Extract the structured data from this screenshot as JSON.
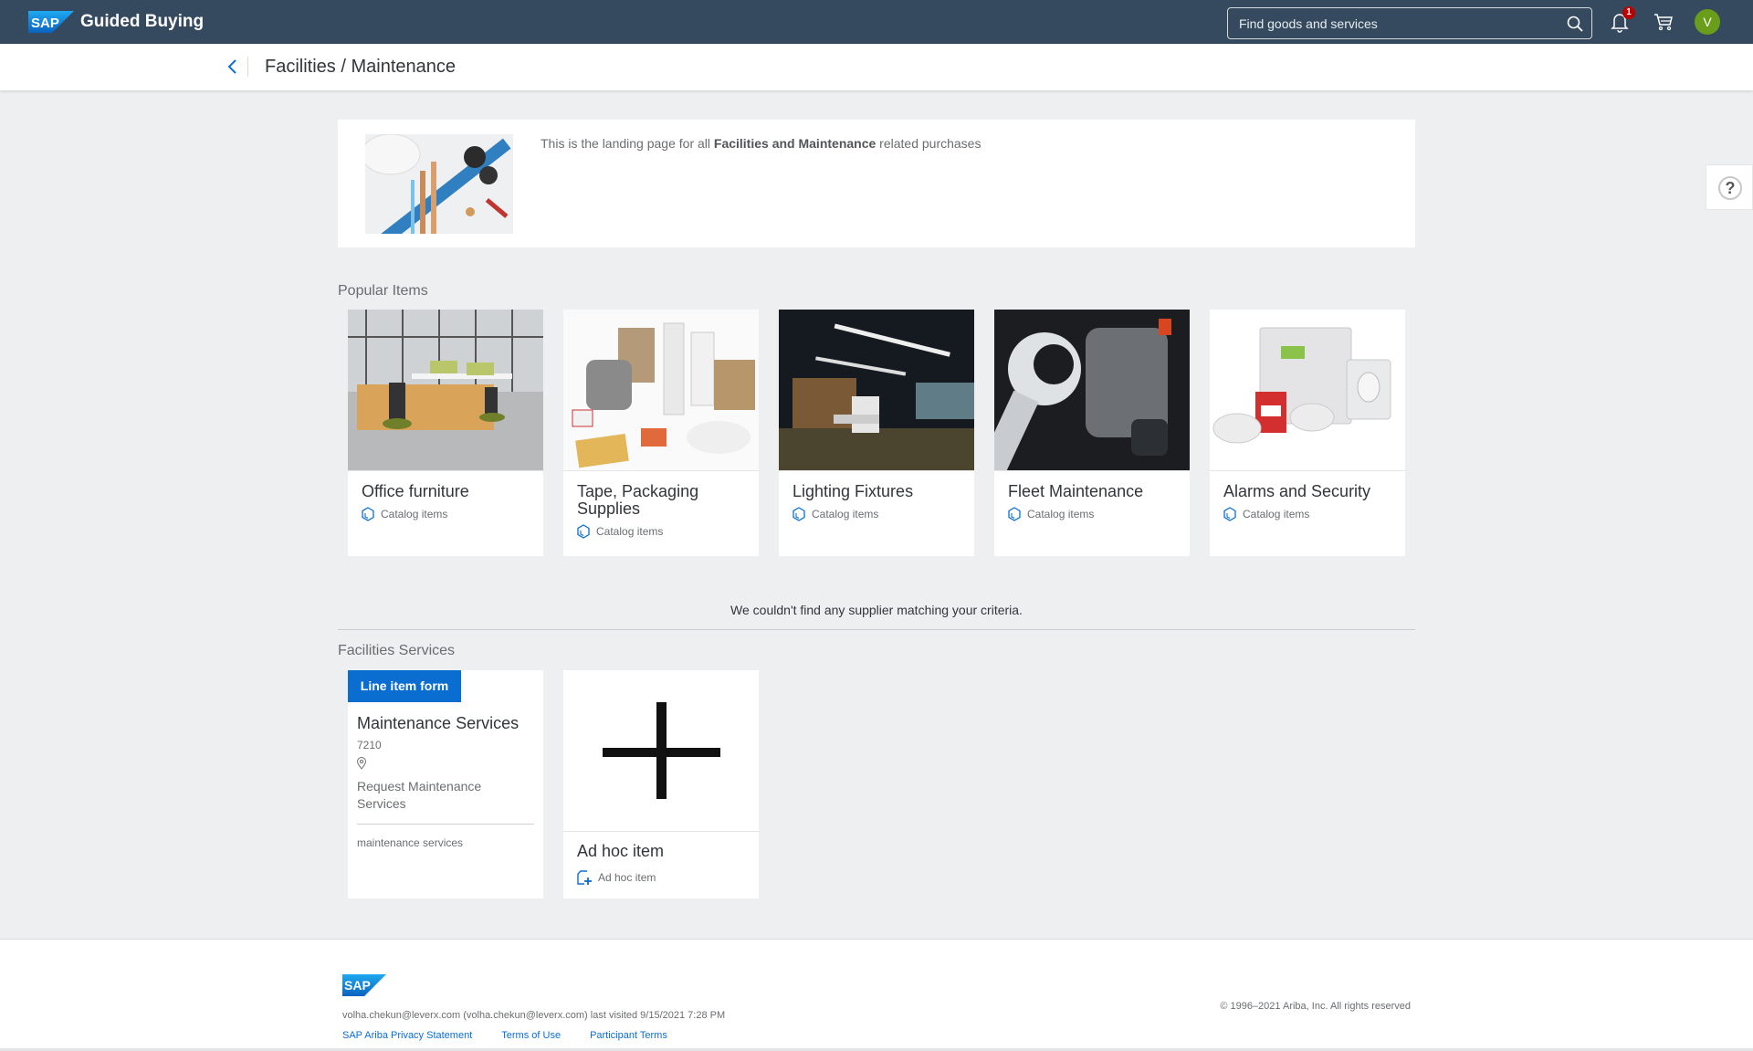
{
  "header": {
    "app_title": "Guided Buying",
    "search_placeholder": "Find goods and services",
    "notification_count": "1",
    "avatar_initial": "V",
    "colors": {
      "shell": "#354a5f",
      "avatar": "#6a9e1a",
      "badge": "#bb0000"
    }
  },
  "subheader": {
    "title": "Facilities / Maintenance"
  },
  "banner": {
    "text_before": "This is the landing page for all ",
    "text_bold": "Facilities and Maintenance",
    "text_after": " related purchases",
    "image_alt": "plumbing tools and pipes"
  },
  "help": {
    "icon_label": "?"
  },
  "popular": {
    "label": "Popular Items",
    "items": [
      {
        "title": "Office furniture",
        "meta": "Catalog items"
      },
      {
        "title": "Tape, Packaging Supplies",
        "meta": "Catalog items"
      },
      {
        "title": "Lighting Fixtures",
        "meta": "Catalog items"
      },
      {
        "title": "Fleet Maintenance",
        "meta": "Catalog items"
      },
      {
        "title": "Alarms and Security",
        "meta": "Catalog items"
      }
    ]
  },
  "suppliers": {
    "empty_message": "We couldn't find any supplier matching your criteria."
  },
  "services": {
    "label": "Facilities Services",
    "form_card": {
      "tag": "Line item form",
      "title": "Maintenance Services",
      "code": "7210",
      "description": "Request Maintenance Services",
      "keywords": "maintenance services"
    },
    "adhoc_card": {
      "title": "Ad hoc item",
      "meta": "Ad hoc item"
    }
  },
  "footer": {
    "user_line": "volha.chekun@leverx.com (volha.chekun@leverx.com) last visited 9/15/2021 7:28 PM",
    "links": [
      "SAP Ariba Privacy Statement",
      "Terms of Use",
      "Participant Terms"
    ],
    "copyright": "© 1996–2021 Ariba, Inc. All rights reserved"
  }
}
